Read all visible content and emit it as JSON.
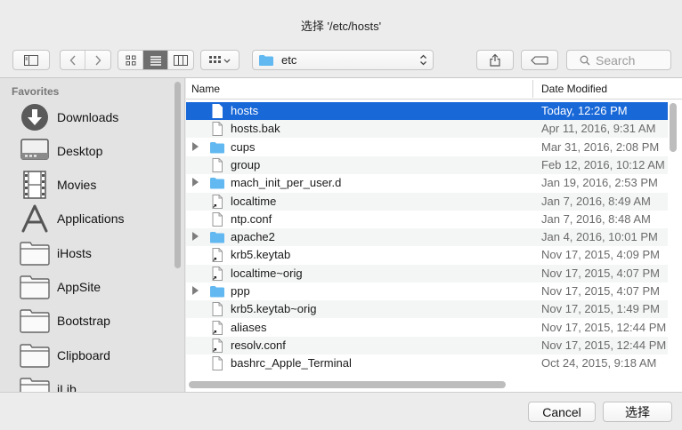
{
  "window": {
    "title": "选择 '/etc/hosts'"
  },
  "toolbar": {
    "location": "etc",
    "search_placeholder": "Search"
  },
  "sidebar": {
    "heading": "Favorites",
    "items": [
      {
        "label": "Downloads",
        "icon": "downloads-icon"
      },
      {
        "label": "Desktop",
        "icon": "desktop-icon"
      },
      {
        "label": "Movies",
        "icon": "movies-icon"
      },
      {
        "label": "Applications",
        "icon": "applications-icon"
      },
      {
        "label": "iHosts",
        "icon": "folder-icon"
      },
      {
        "label": "AppSite",
        "icon": "folder-icon"
      },
      {
        "label": "Bootstrap",
        "icon": "folder-icon"
      },
      {
        "label": "Clipboard",
        "icon": "folder-icon"
      },
      {
        "label": "iLib",
        "icon": "folder-icon"
      }
    ]
  },
  "file_list": {
    "columns": {
      "name": "Name",
      "date": "Date Modified"
    },
    "rows": [
      {
        "name": "hosts",
        "date": "Today, 12:26 PM",
        "kind": "file",
        "selected": true
      },
      {
        "name": "hosts.bak",
        "date": "Apr 11, 2016, 9:31 AM",
        "kind": "file"
      },
      {
        "name": "cups",
        "date": "Mar 31, 2016, 2:08 PM",
        "kind": "folder"
      },
      {
        "name": "group",
        "date": "Feb 12, 2016, 10:12 AM",
        "kind": "file"
      },
      {
        "name": "mach_init_per_user.d",
        "date": "Jan 19, 2016, 2:53 PM",
        "kind": "folder"
      },
      {
        "name": "localtime",
        "date": "Jan 7, 2016, 8:49 AM",
        "kind": "alias"
      },
      {
        "name": "ntp.conf",
        "date": "Jan 7, 2016, 8:48 AM",
        "kind": "file"
      },
      {
        "name": "apache2",
        "date": "Jan 4, 2016, 10:01 PM",
        "kind": "folder"
      },
      {
        "name": "krb5.keytab",
        "date": "Nov 17, 2015, 4:09 PM",
        "kind": "alias"
      },
      {
        "name": "localtime~orig",
        "date": "Nov 17, 2015, 4:07 PM",
        "kind": "alias"
      },
      {
        "name": "ppp",
        "date": "Nov 17, 2015, 4:07 PM",
        "kind": "folder"
      },
      {
        "name": "krb5.keytab~orig",
        "date": "Nov 17, 2015, 1:49 PM",
        "kind": "file"
      },
      {
        "name": "aliases",
        "date": "Nov 17, 2015, 12:44 PM",
        "kind": "alias"
      },
      {
        "name": "resolv.conf",
        "date": "Nov 17, 2015, 12:44 PM",
        "kind": "alias"
      },
      {
        "name": "bashrc_Apple_Terminal",
        "date": "Oct 24, 2015, 9:18 AM",
        "kind": "file"
      }
    ]
  },
  "footer": {
    "cancel_label": "Cancel",
    "confirm_label": "选择"
  },
  "colors": {
    "selection": "#1968d8",
    "folder": "#62b8f0"
  }
}
